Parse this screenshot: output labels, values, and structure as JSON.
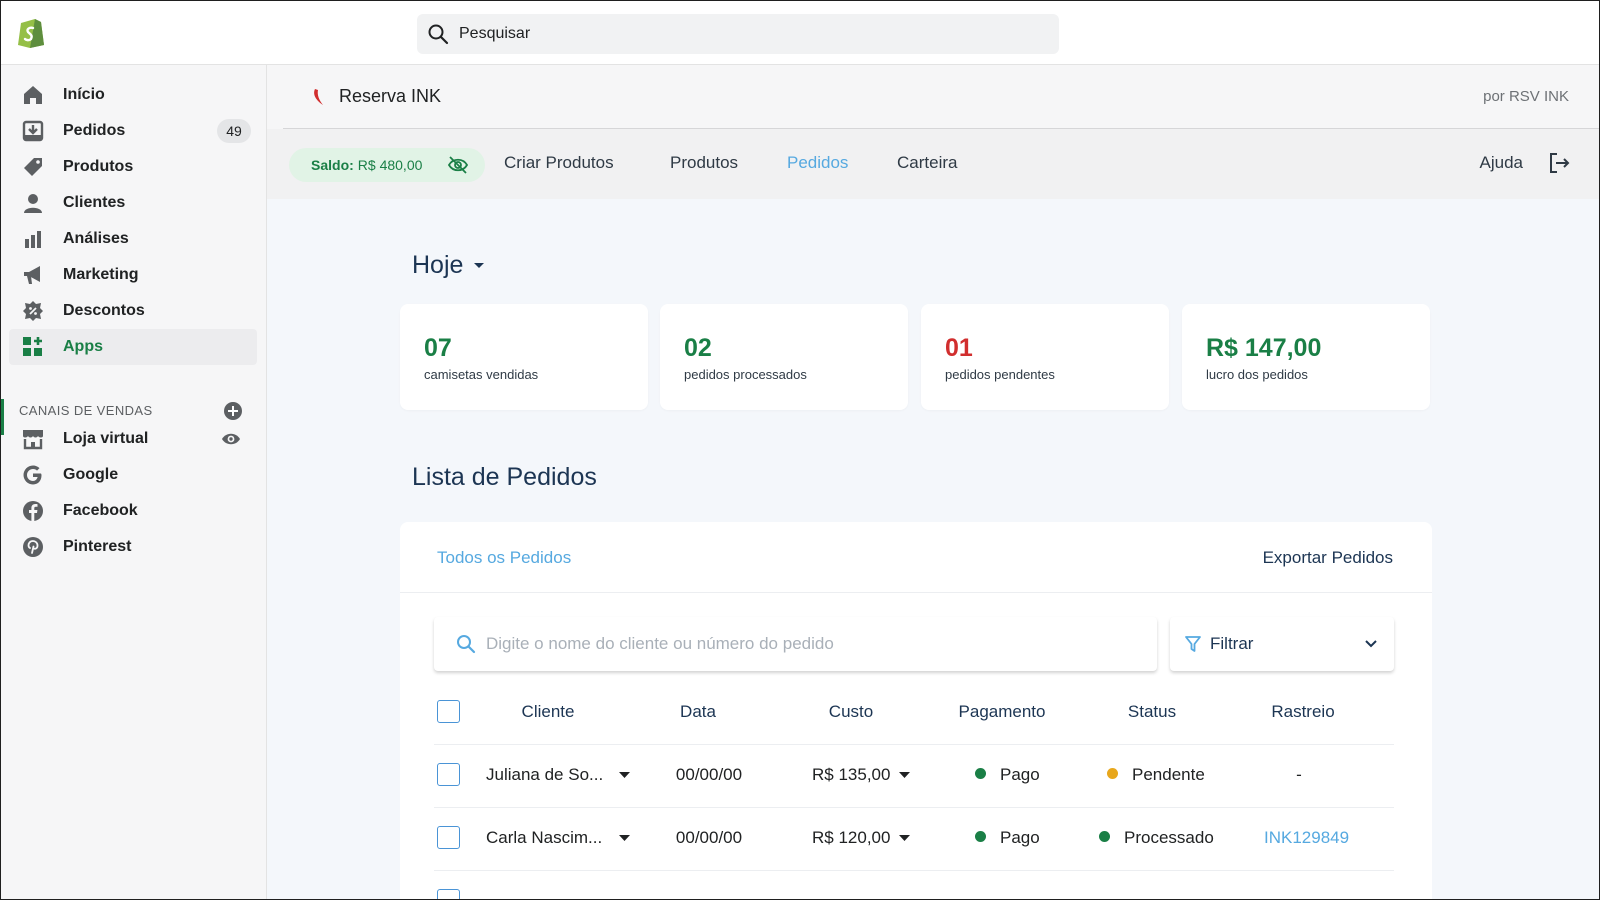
{
  "topbar": {
    "search_placeholder": "Pesquisar"
  },
  "sidebar": {
    "items": [
      {
        "label": "Início",
        "icon": "home-icon"
      },
      {
        "label": "Pedidos",
        "icon": "orders-icon",
        "badge": "49"
      },
      {
        "label": "Produtos",
        "icon": "tag-icon"
      },
      {
        "label": "Clientes",
        "icon": "person-icon"
      },
      {
        "label": "Análises",
        "icon": "bar-chart-icon"
      },
      {
        "label": "Marketing",
        "icon": "megaphone-icon"
      },
      {
        "label": "Descontos",
        "icon": "discount-icon"
      },
      {
        "label": "Apps",
        "icon": "apps-icon",
        "active": true
      }
    ],
    "channels_title": "CANAIS DE VENDAS",
    "channels": [
      {
        "label": "Loja virtual",
        "icon": "store-icon"
      },
      {
        "label": "Google",
        "icon": "google-icon"
      },
      {
        "label": "Facebook",
        "icon": "facebook-icon"
      },
      {
        "label": "Pinterest",
        "icon": "pinterest-icon"
      }
    ]
  },
  "app_header": {
    "name": "Reserva INK",
    "by": "por RSV INK"
  },
  "app_nav": {
    "saldo_label": "Saldo:",
    "saldo_value": "R$ 480,00",
    "tabs": [
      "Criar Produtos",
      "Produtos",
      "Pedidos",
      "Carteira"
    ],
    "active_tab": "Pedidos",
    "help": "Ajuda"
  },
  "period": "Hoje",
  "stats": [
    {
      "value": "07",
      "caption": "camisetas vendidas",
      "color": "#1a7f46"
    },
    {
      "value": "02",
      "caption": "pedidos processados",
      "color": "#1a7f46"
    },
    {
      "value": "01",
      "caption": "pedidos pendentes",
      "color": "#d12e2e"
    },
    {
      "value": "R$ 147,00",
      "caption": "lucro dos pedidos",
      "color": "#1a7f46"
    }
  ],
  "orders": {
    "title": "Lista de Pedidos",
    "filter_all": "Todos os Pedidos",
    "export": "Exportar Pedidos",
    "search_placeholder": "Digite o nome do cliente ou número do pedido",
    "filter_label": "Filtrar",
    "columns": [
      "Cliente",
      "Data",
      "Custo",
      "Pagamento",
      "Status",
      "Rastreio"
    ],
    "rows": [
      {
        "cliente": "Juliana de So...",
        "data": "00/00/00",
        "custo": "R$ 135,00",
        "pagamento": "Pago",
        "status": "Pendente",
        "status_color": "#e8a71c",
        "rastreio": "-"
      },
      {
        "cliente": "Carla Nascim...",
        "data": "00/00/00",
        "custo": "R$ 120,00",
        "pagamento": "Pago",
        "status": "Processado",
        "status_color": "#1a7f46",
        "rastreio": "INK129849"
      }
    ]
  },
  "colors": {
    "accent_green": "#1a7f46",
    "link_blue": "#56a9e0",
    "navy": "#1c3553",
    "paid_green": "#1a7f46",
    "pending_amber": "#e8a71c"
  }
}
